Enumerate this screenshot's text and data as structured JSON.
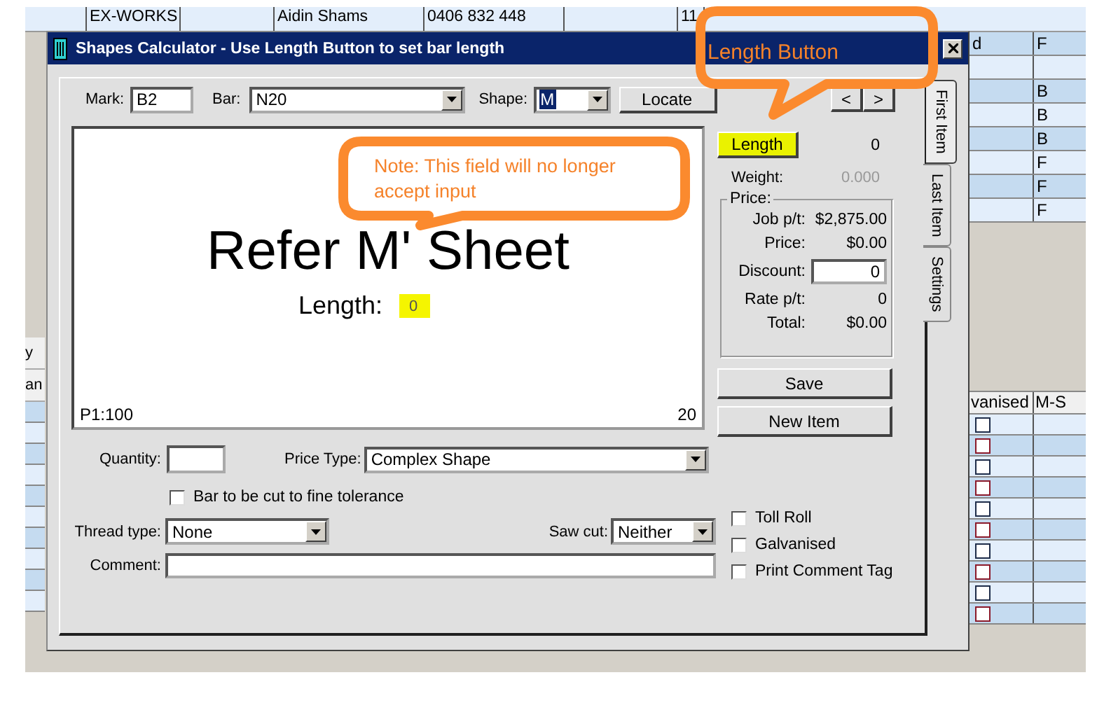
{
  "background_table": {
    "top_row": [
      "EX-WORKS",
      "Aidin Shams",
      "0406 832 448",
      "11"
    ],
    "right_rows": [
      {
        "column_1": "d",
        "column_2": "F"
      },
      {
        "column_1": "",
        "column_2": ""
      },
      {
        "column_1": "",
        "column_2": "B"
      },
      {
        "column_1": "",
        "column_2": "B"
      },
      {
        "column_1": "",
        "column_2": "B"
      },
      {
        "column_1": "",
        "column_2": "F"
      },
      {
        "column_1": "",
        "column_2": "F"
      },
      {
        "column_1": "",
        "column_2": "F"
      }
    ],
    "left_labels": [
      "y",
      "an"
    ],
    "lower_columns": [
      "vanised",
      "M-S"
    ],
    "lower_rows": [
      {
        "checked": false,
        "color": "#1f2d4a"
      },
      {
        "checked": false,
        "color": "#8b1a2b"
      },
      {
        "checked": false,
        "color": "#1f2d4a"
      },
      {
        "checked": false,
        "color": "#8b1a2b"
      },
      {
        "checked": false,
        "color": "#1f2d4a"
      },
      {
        "checked": false,
        "color": "#8b1a2b"
      },
      {
        "checked": false,
        "color": "#1f2d4a"
      },
      {
        "checked": false,
        "color": "#8b1a2b"
      },
      {
        "checked": false,
        "color": "#1f2d4a"
      },
      {
        "checked": false,
        "color": "#8b1a2b"
      }
    ]
  },
  "dialog": {
    "title": "Shapes Calculator - Use Length Button to set bar length",
    "mark": {
      "label": "Mark:",
      "value": "B2"
    },
    "bar": {
      "label": "Bar:",
      "value": "N20"
    },
    "shape": {
      "label": "Shape:",
      "value": "M"
    },
    "locate_button": "Locate",
    "nav_buttons": [
      "<",
      ">"
    ],
    "preview": {
      "heading": "Refer M' Sheet",
      "length_label": "Length:",
      "length_value": "0",
      "length_highlighted": true,
      "scale": "P1:100",
      "number": "20"
    },
    "length_button": {
      "label": "Length",
      "highlighted": true
    },
    "length_reading": "0",
    "weight": {
      "label": "Weight:",
      "value": "0.000",
      "disabled": true
    },
    "price": {
      "title": "Price:",
      "rows": [
        {
          "kind": "text",
          "label": "Job p/t:",
          "value": "$2,875.00"
        },
        {
          "kind": "text",
          "label": "Price:",
          "value": "$0.00"
        },
        {
          "kind": "input",
          "label": "Discount:",
          "value": "0"
        },
        {
          "kind": "text",
          "label": "Rate p/t:",
          "value": "0"
        },
        {
          "kind": "text",
          "label": "Total:",
          "value": "$0.00"
        }
      ]
    },
    "buttons": [
      "Save",
      "New Item"
    ],
    "quantity": {
      "label": "Quantity:"
    },
    "price_type": {
      "label": "Price Type:",
      "value": "Complex Shape"
    },
    "fine_tolerance": {
      "label": "Bar to be cut to fine tolerance",
      "checked": false
    },
    "thread_type": {
      "label": "Thread type:",
      "value": "None"
    },
    "saw_cut": {
      "label": "Saw cut:",
      "value": "Neither"
    },
    "comment": {
      "label": "Comment:"
    },
    "options": [
      {
        "label": "Toll Roll",
        "checked": false
      },
      {
        "label": "Galvanised",
        "checked": false
      },
      {
        "label": "Print Comment Tag",
        "checked": false
      }
    ],
    "tabs": [
      {
        "label": "First Item",
        "selected": true
      },
      {
        "label": "Last Item",
        "selected": false
      },
      {
        "label": "Settings",
        "selected": false
      }
    ]
  },
  "callouts": [
    {
      "text": "Length Button"
    },
    {
      "text": "Note: This field will no longer accept input"
    }
  ]
}
